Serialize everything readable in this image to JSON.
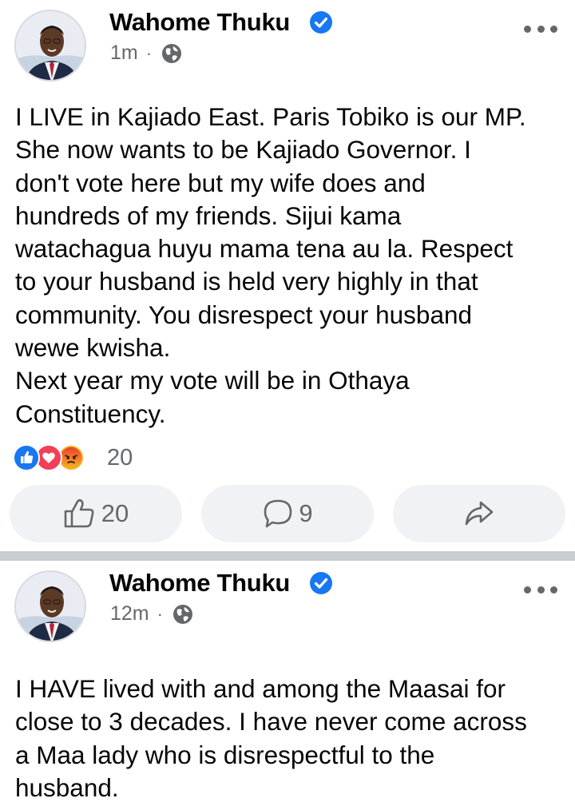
{
  "posts": [
    {
      "author": "Wahome Thuku",
      "verified": true,
      "time": "1m",
      "separator": "·",
      "audience_icon": "globe-icon",
      "body_lines": [
        "I LIVE in Kajiado East. Paris Tobiko is our MP.",
        "She now wants to be Kajiado Governor. I",
        "don't vote here but my wife does and",
        "hundreds of my friends. Sijui kama",
        "watachagua huyu mama tena au la. Respect",
        "to your husband is held very highly in that",
        "community. You disrespect your husband",
        "wewe kwisha.",
        "Next year my vote will be in Othaya",
        "Constituency."
      ],
      "reactions": {
        "icons": [
          "like-icon",
          "love-icon",
          "angry-icon"
        ],
        "count": "20"
      },
      "actions": {
        "like_count": "20",
        "comment_count": "9",
        "share_icon": "share-icon"
      }
    },
    {
      "author": "Wahome Thuku",
      "verified": true,
      "time": "12m",
      "separator": "·",
      "audience_icon": "globe-icon",
      "body_lines": [
        "I HAVE lived with and among the Maasai for",
        "close to 3 decades. I have never come across",
        "a Maa lady who is disrespectful to the",
        "husband."
      ]
    }
  ],
  "colors": {
    "accent": "#1877f2",
    "secondary_text": "#65676b",
    "button_bg": "#f0f2f5",
    "divider": "#c9ccd1"
  }
}
